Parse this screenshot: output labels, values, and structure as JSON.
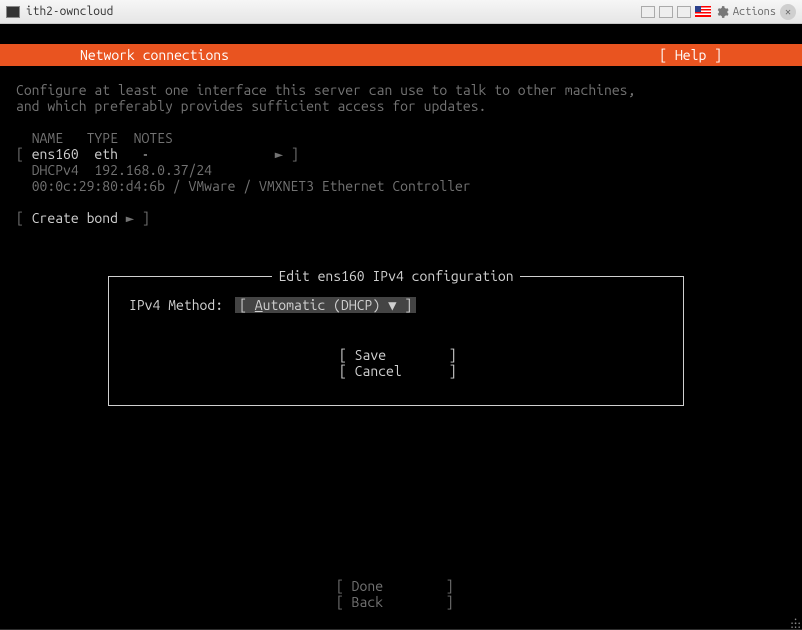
{
  "titlebar": {
    "title": "ith2-owncloud",
    "actions": "Actions"
  },
  "header": {
    "title": "Network connections",
    "help": "[ Help ]"
  },
  "intro": {
    "line1": "Configure at least one interface this server can use to talk to other machines,",
    "line2": "and which preferably provides sufficient access for updates."
  },
  "columns": {
    "name": "NAME",
    "type": "TYPE",
    "notes": "NOTES"
  },
  "iface": {
    "open": "[ ",
    "name": "ens160",
    "type": "eth",
    "notes": "-",
    "arrow": "►",
    "close": " ]",
    "dhcp_label": "DHCPv4",
    "address": "192.168.0.37/24",
    "mac": "00:0c:29:80:d4:6b / VMware / VMXNET3 Ethernet Controller"
  },
  "create_bond": {
    "open": "[ ",
    "label": "Create bond",
    "arrow": "►",
    "close": " ]"
  },
  "dialog": {
    "title": "Edit ens160 IPv4 configuration",
    "method_label": "IPv4 Method:",
    "method_open": "[ ",
    "method_first": "A",
    "method_rest": "utomatic (DHCP)",
    "method_arrow": " ▼",
    "method_close": " ]",
    "save": "[ Save        ]",
    "cancel": "[ Cancel      ]"
  },
  "footer": {
    "done": "[ Done        ]",
    "back": "[ Back        ]"
  }
}
